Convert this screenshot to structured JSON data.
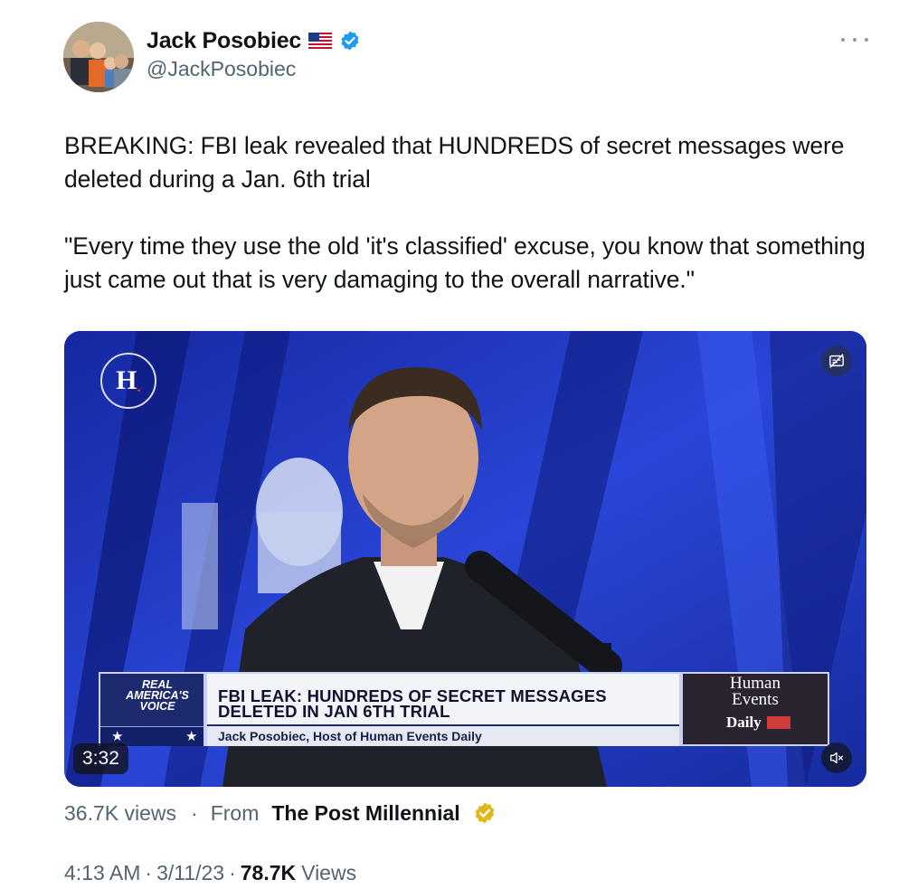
{
  "author": {
    "display_name": "Jack Posobiec",
    "handle": "@JackPosobiec",
    "flag_icon": "us-flag-icon",
    "verified_icon": "verified-badge-icon",
    "verified_color": "#1d9bf0"
  },
  "tweet": {
    "text": "BREAKING: FBI leak revealed that HUNDREDS of secret messages were deleted during a Jan. 6th trial\n\n\"Every time they use the old 'it's classified' excuse, you know that something just came out that is very damaging to the overall narrative.\""
  },
  "video": {
    "duration": "3:32",
    "logo_letter": "H",
    "lower_third": {
      "network": "REAL AMERICA'S VOICE",
      "headline": "FBI LEAK: HUNDREDS OF SECRET MESSAGES DELETED IN JAN 6TH TRIAL",
      "subtitle": "Jack Posobiec, Host of Human Events Daily",
      "show_line1": "Human",
      "show_line2": "Events",
      "show_line3": "Daily"
    }
  },
  "stats": {
    "video_views": "36.7K views",
    "separator": "·",
    "from_label": "From",
    "source": "The Post Millennial",
    "source_badge_color": "#e2b719",
    "time": "4:13 AM",
    "date": "3/11/23",
    "views_count": "78.7K",
    "views_label": "Views"
  }
}
